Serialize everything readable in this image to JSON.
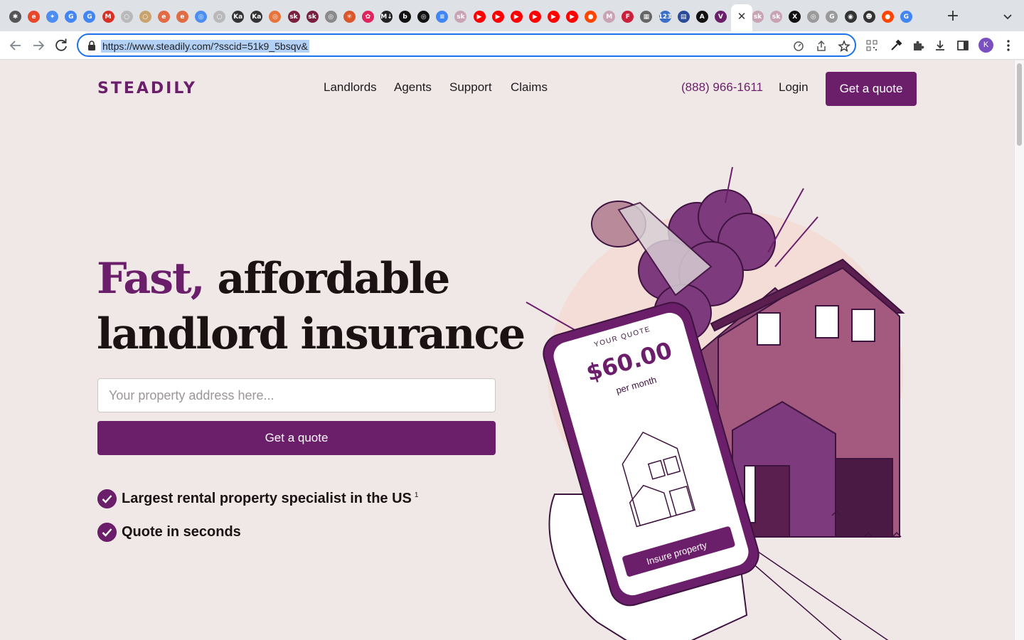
{
  "browser": {
    "url": "https://www.steadily.com/?sscid=51k9_5bsqv&",
    "profile_initial": "K",
    "tab_favicons": [
      {
        "name": "tab-favicon-1",
        "color": "#555555",
        "glyph": "✱"
      },
      {
        "name": "tab-favicon-2",
        "color": "#e8472a",
        "glyph": "e"
      },
      {
        "name": "tab-favicon-3",
        "color": "#4d8ef0",
        "glyph": "✦"
      },
      {
        "name": "tab-favicon-google",
        "color": "#4285f4",
        "glyph": "G"
      },
      {
        "name": "tab-favicon-google-2",
        "color": "#4285f4",
        "glyph": "G"
      },
      {
        "name": "tab-favicon-gmail",
        "color": "#d93025",
        "glyph": "M"
      },
      {
        "name": "tab-favicon-7",
        "color": "#b9b9b9",
        "glyph": "○"
      },
      {
        "name": "tab-favicon-8",
        "color": "#c9a36e",
        "glyph": "○"
      },
      {
        "name": "tab-favicon-9",
        "color": "#e06b45",
        "glyph": "e"
      },
      {
        "name": "tab-favicon-10",
        "color": "#e06b45",
        "glyph": "e"
      },
      {
        "name": "tab-favicon-11",
        "color": "#4d8ef0",
        "glyph": "◎"
      },
      {
        "name": "tab-favicon-12",
        "color": "#b9b9b9",
        "glyph": "○"
      },
      {
        "name": "tab-favicon-ka",
        "color": "#333333",
        "glyph": "Ka"
      },
      {
        "name": "tab-favicon-ka-2",
        "color": "#333333",
        "glyph": "Ka"
      },
      {
        "name": "tab-favicon-15",
        "color": "#e8733b",
        "glyph": "◎"
      },
      {
        "name": "tab-favicon-sk",
        "color": "#7a1f3d",
        "glyph": "sk"
      },
      {
        "name": "tab-favicon-sk-2",
        "color": "#7a1f3d",
        "glyph": "sk"
      },
      {
        "name": "tab-favicon-18",
        "color": "#8a8a8a",
        "glyph": "◎"
      },
      {
        "name": "tab-favicon-19",
        "color": "#d9572b",
        "glyph": "✳"
      },
      {
        "name": "tab-favicon-20",
        "color": "#e0245e",
        "glyph": "✿"
      },
      {
        "name": "tab-favicon-mi",
        "color": "#222222",
        "glyph": "M↓"
      },
      {
        "name": "tab-favicon-b",
        "color": "#111111",
        "glyph": "b"
      },
      {
        "name": "tab-favicon-openai",
        "color": "#111111",
        "glyph": "◎"
      },
      {
        "name": "tab-favicon-docs",
        "color": "#4285f4",
        "glyph": "≡"
      },
      {
        "name": "tab-favicon-25",
        "color": "#c9a3b3",
        "glyph": "sk"
      },
      {
        "name": "tab-favicon-youtube",
        "color": "#ff0000",
        "glyph": "▶"
      },
      {
        "name": "tab-favicon-youtube-2",
        "color": "#ff0000",
        "glyph": "▶"
      },
      {
        "name": "tab-favicon-youtube-3",
        "color": "#ff0000",
        "glyph": "▶"
      },
      {
        "name": "tab-favicon-youtube-4",
        "color": "#ff0000",
        "glyph": "▶"
      },
      {
        "name": "tab-favicon-youtube-5",
        "color": "#ff0000",
        "glyph": "▶"
      },
      {
        "name": "tab-favicon-youtube-6",
        "color": "#ff0000",
        "glyph": "▶"
      },
      {
        "name": "tab-favicon-reddit",
        "color": "#ff4500",
        "glyph": "●"
      },
      {
        "name": "tab-favicon-33",
        "color": "#c9a3b3",
        "glyph": "M"
      },
      {
        "name": "tab-favicon-34",
        "color": "#cc1f3b",
        "glyph": "F"
      },
      {
        "name": "tab-favicon-35",
        "color": "#666666",
        "glyph": "▦"
      },
      {
        "name": "tab-favicon-123",
        "color": "#3b6fc9",
        "glyph": "123"
      },
      {
        "name": "tab-favicon-37",
        "color": "#2a4a9a",
        "glyph": "▤"
      },
      {
        "name": "tab-favicon-38",
        "color": "#111111",
        "glyph": "A"
      },
      {
        "name": "tab-favicon-active",
        "color": "#6b1f6b",
        "glyph": "V"
      },
      {
        "name": "tab-favicon-40",
        "color": "#8b2fc9",
        "glyph": "m"
      },
      {
        "name": "tab-favicon-41",
        "color": "#c9a3b3",
        "glyph": "sk"
      },
      {
        "name": "tab-favicon-42",
        "color": "#c9a3b3",
        "glyph": "sk"
      },
      {
        "name": "tab-favicon-x",
        "color": "#111111",
        "glyph": "X"
      },
      {
        "name": "tab-favicon-44",
        "color": "#9a9a9a",
        "glyph": "◎"
      },
      {
        "name": "tab-favicon-45",
        "color": "#9a9a9a",
        "glyph": "G"
      },
      {
        "name": "tab-favicon-github",
        "color": "#333333",
        "glyph": "◉"
      },
      {
        "name": "tab-favicon-47",
        "color": "#333333",
        "glyph": "☻"
      },
      {
        "name": "tab-favicon-reddit-2",
        "color": "#ff4500",
        "glyph": "●"
      },
      {
        "name": "tab-favicon-google-3",
        "color": "#4285f4",
        "glyph": "G"
      }
    ]
  },
  "site": {
    "logo": "STEADILY",
    "nav": {
      "landlords": "Landlords",
      "agents": "Agents",
      "support": "Support",
      "claims": "Claims"
    },
    "phone": "(888) 966-1611",
    "login": "Login",
    "get_quote_top": "Get a quote"
  },
  "hero": {
    "title_accent": "Fast,",
    "title_rest_line1": " affordable",
    "title_line2": "landlord insurance",
    "address_placeholder": "Your property address here...",
    "address_value": "",
    "get_quote_main": "Get a quote",
    "checks": [
      {
        "text": "Largest rental property specialist in the US",
        "footnote": "1"
      },
      {
        "text": "Quote in seconds",
        "footnote": ""
      }
    ]
  },
  "illustration": {
    "quote_label": "YOUR QUOTE",
    "quote_amount": "$60.00",
    "quote_period": "per month",
    "insure_button": "Insure property"
  },
  "colors": {
    "brand": "#6b1f6b",
    "background": "#efe8e6"
  }
}
